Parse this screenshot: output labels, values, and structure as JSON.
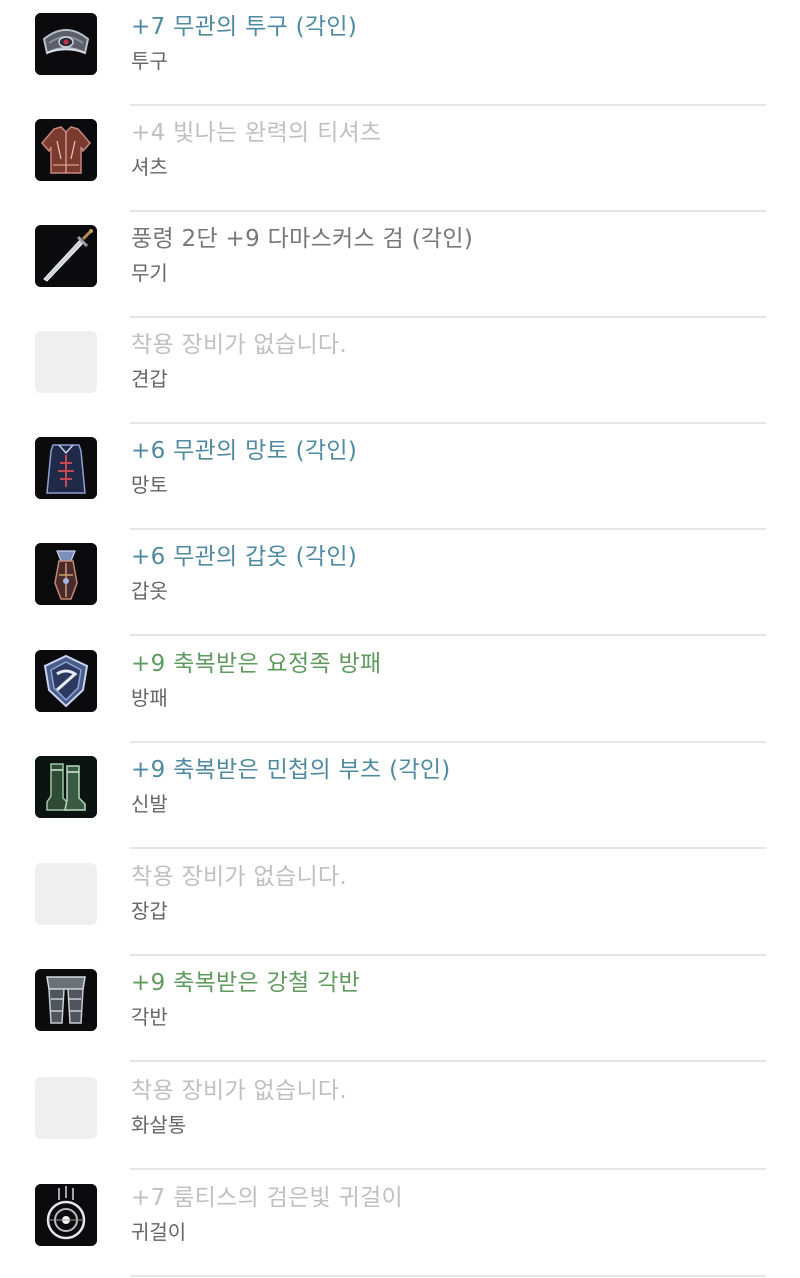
{
  "equipment": [
    {
      "name": "+7  무관의 투구 (각인)",
      "slot": "투구",
      "color": "#4f8aa0",
      "icon": "helmet-icon"
    },
    {
      "name": "+4  빛나는 완력의 티셔츠",
      "slot": "셔츠",
      "color": "#c0c0c0",
      "icon": "shirt-icon"
    },
    {
      "name": "풍령 2단 +9  다마스커스 검 (각인)",
      "slot": "무기",
      "color": "#777777",
      "icon": "sword-icon"
    },
    {
      "name": "착용 장비가 없습니다.",
      "slot": "견갑",
      "color": "#c0c0c0",
      "icon": "empty-slot"
    },
    {
      "name": "+6  무관의 망토 (각인)",
      "slot": "망토",
      "color": "#4f8aa0",
      "icon": "cloak-icon"
    },
    {
      "name": "+6  무관의 갑옷 (각인)",
      "slot": "갑옷",
      "color": "#4f8aa0",
      "icon": "armor-icon"
    },
    {
      "name": "+9  축복받은 요정족 방패",
      "slot": "방패",
      "color": "#5f9a5f",
      "icon": "shield-icon"
    },
    {
      "name": "+9  축복받은 민첩의 부츠 (각인)",
      "slot": "신발",
      "color": "#4f8aa0",
      "icon": "boots-icon"
    },
    {
      "name": "착용 장비가 없습니다.",
      "slot": "장갑",
      "color": "#c0c0c0",
      "icon": "empty-slot"
    },
    {
      "name": "+9  축복받은 강철 각반",
      "slot": "각반",
      "color": "#5f9a5f",
      "icon": "greaves-icon"
    },
    {
      "name": "착용 장비가 없습니다.",
      "slot": "화살통",
      "color": "#c0c0c0",
      "icon": "empty-slot"
    },
    {
      "name": "+7  룸티스의 검은빛 귀걸이",
      "slot": "귀걸이",
      "color": "#c0c0c0",
      "icon": "earring-icon"
    }
  ]
}
